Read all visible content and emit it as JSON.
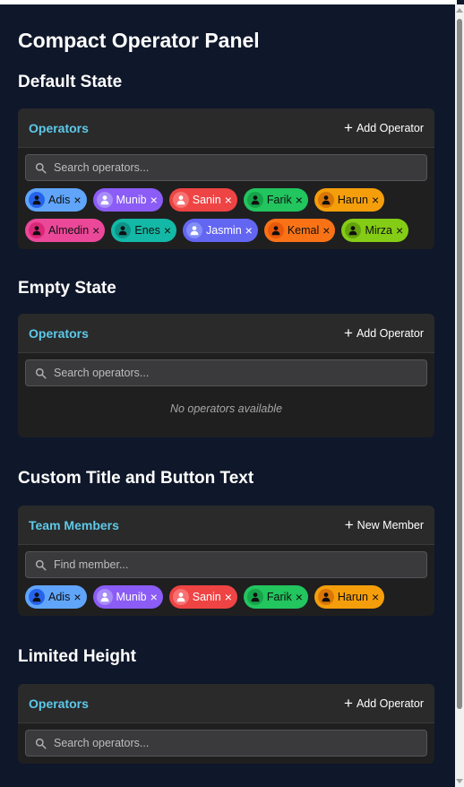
{
  "page_title": "Compact Operator Panel",
  "sections": [
    {
      "heading": "Default State",
      "panel_title": "Operators",
      "button_label": "Add Operator",
      "search_placeholder": "Search operators...",
      "chips": [
        {
          "name": "Adis",
          "color": "#60a5fa",
          "avatar": "#2563eb",
          "icon": "#0f0f0f",
          "light": false
        },
        {
          "name": "Munib",
          "color": "#8b5cf6",
          "avatar": "#a78bfa",
          "icon": "#ffffff",
          "light": true
        },
        {
          "name": "Sanin",
          "color": "#ef4444",
          "avatar": "#f87171",
          "icon": "#ffffff",
          "light": true
        },
        {
          "name": "Farik",
          "color": "#22c55e",
          "avatar": "#16a34a",
          "icon": "#0f0f0f",
          "light": false
        },
        {
          "name": "Harun",
          "color": "#f59e0b",
          "avatar": "#d97706",
          "icon": "#0f0f0f",
          "light": false
        },
        {
          "name": "Almedin",
          "color": "#ec4899",
          "avatar": "#db2777",
          "icon": "#0f0f0f",
          "light": false
        },
        {
          "name": "Enes",
          "color": "#14b8a6",
          "avatar": "#0d9488",
          "icon": "#0f0f0f",
          "light": false
        },
        {
          "name": "Jasmin",
          "color": "#6366f1",
          "avatar": "#818cf8",
          "icon": "#ffffff",
          "light": true
        },
        {
          "name": "Kemal",
          "color": "#f97316",
          "avatar": "#ea580c",
          "icon": "#0f0f0f",
          "light": false
        },
        {
          "name": "Mirza",
          "color": "#84cc16",
          "avatar": "#65a30d",
          "icon": "#0f0f0f",
          "light": false
        }
      ]
    },
    {
      "heading": "Empty State",
      "panel_title": "Operators",
      "button_label": "Add Operator",
      "search_placeholder": "Search operators...",
      "empty_message": "No operators available",
      "chips": []
    },
    {
      "heading": "Custom Title and Button Text",
      "panel_title": "Team Members",
      "button_label": "New Member",
      "search_placeholder": "Find member...",
      "chips": [
        {
          "name": "Adis",
          "color": "#60a5fa",
          "avatar": "#2563eb",
          "icon": "#0f0f0f",
          "light": false
        },
        {
          "name": "Munib",
          "color": "#8b5cf6",
          "avatar": "#a78bfa",
          "icon": "#ffffff",
          "light": true
        },
        {
          "name": "Sanin",
          "color": "#ef4444",
          "avatar": "#f87171",
          "icon": "#ffffff",
          "light": true
        },
        {
          "name": "Farik",
          "color": "#22c55e",
          "avatar": "#16a34a",
          "icon": "#0f0f0f",
          "light": false
        },
        {
          "name": "Harun",
          "color": "#f59e0b",
          "avatar": "#d97706",
          "icon": "#0f0f0f",
          "light": false
        }
      ]
    },
    {
      "heading": "Limited Height",
      "panel_title": "Operators",
      "button_label": "Add Operator",
      "search_placeholder": "Search operators...",
      "chips": []
    }
  ],
  "icons": {
    "search": "search-icon",
    "add": "plus-icon",
    "avatar": "user-icon",
    "remove": "close-icon"
  },
  "remove_glyph": "×",
  "add_glyph": "+"
}
